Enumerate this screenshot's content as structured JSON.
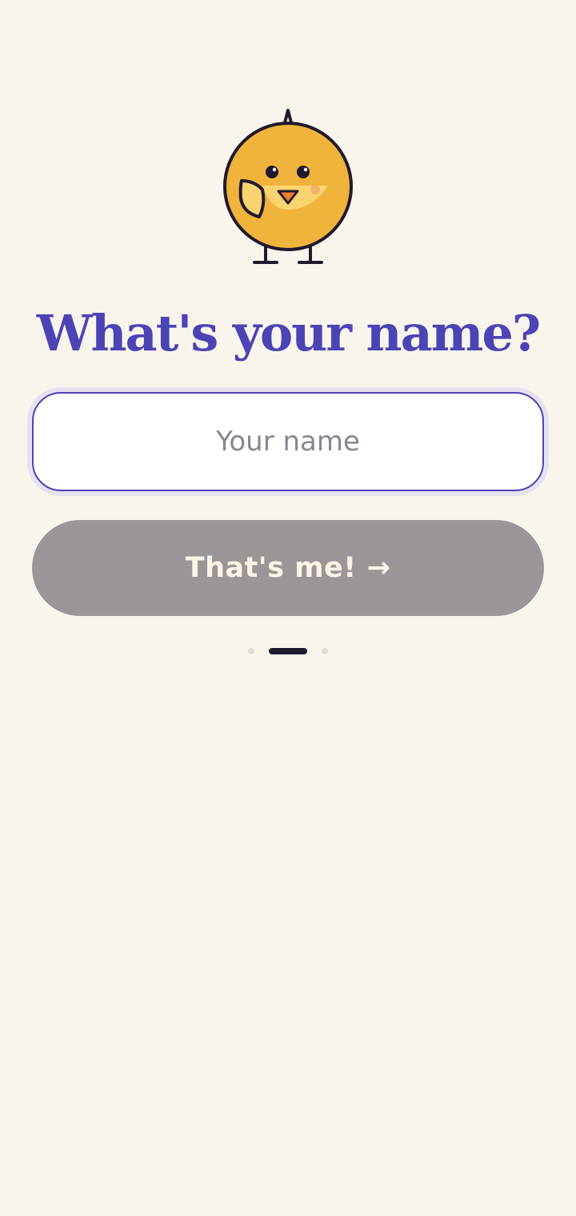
{
  "onboarding": {
    "mascot_icon": "chick-mascot-icon",
    "title": "What's your name?",
    "name_field": {
      "value": "",
      "placeholder": "Your name"
    },
    "submit_label": "That's me! →",
    "submit_enabled": false,
    "progress": {
      "total_steps": 3,
      "current_step": 2
    }
  },
  "colors": {
    "background": "#f9f5ec",
    "accent": "#4b44b5",
    "button_disabled": "#9a9597",
    "mascot_body": "#f0b33b",
    "mascot_outline": "#1f1a2e"
  }
}
